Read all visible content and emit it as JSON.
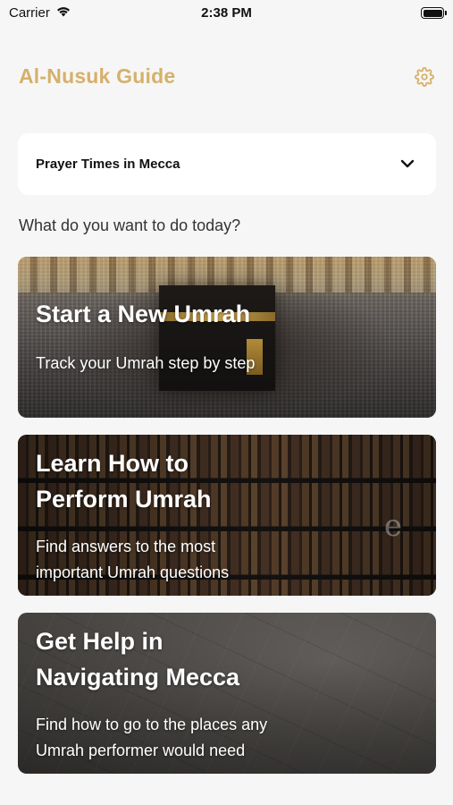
{
  "status_bar": {
    "carrier": "Carrier",
    "time": "2:38 PM"
  },
  "header": {
    "title": "Al-Nusuk Guide",
    "settings_icon": "gear-icon",
    "accent_color": "#d6b06b"
  },
  "prayer_times": {
    "label": "Prayer Times in Mecca",
    "icon": "chevron-down-icon"
  },
  "prompt": "What do you want to do today?",
  "cards": [
    {
      "title_lines": [
        "Start a New Umrah"
      ],
      "description_lines": [
        "Track your Umrah step by step"
      ]
    },
    {
      "title_lines": [
        "Learn How to",
        "Perform Umrah"
      ],
      "description_lines": [
        "Find answers to the most",
        "important Umrah questions"
      ]
    },
    {
      "title_lines": [
        "Get Help in",
        "Navigating Mecca"
      ],
      "description_lines": [
        "Find how to go to the places any",
        "Umrah performer would need"
      ]
    }
  ]
}
